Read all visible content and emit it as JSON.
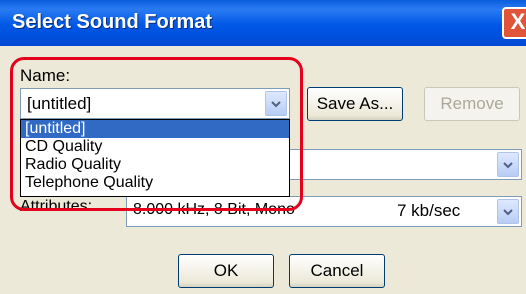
{
  "window": {
    "title": "Select Sound Format",
    "close_glyph": "X"
  },
  "name_label": "Name:",
  "name_select": {
    "value": "[untitled]"
  },
  "buttons": {
    "save_as": "Save As...",
    "remove": "Remove",
    "ok": "OK",
    "cancel": "Cancel"
  },
  "dropdown_options": [
    "[untitled]",
    "CD Quality",
    "Radio Quality",
    "Telephone Quality"
  ],
  "attributes": {
    "label": "Attributes:",
    "value": "8.000 kHz, 8 Bit, Mono",
    "rate": "7 kb/sec"
  },
  "colors": {
    "highlight": "#e5001c",
    "selection": "#316ac5",
    "titlebar": "#0057e6"
  }
}
